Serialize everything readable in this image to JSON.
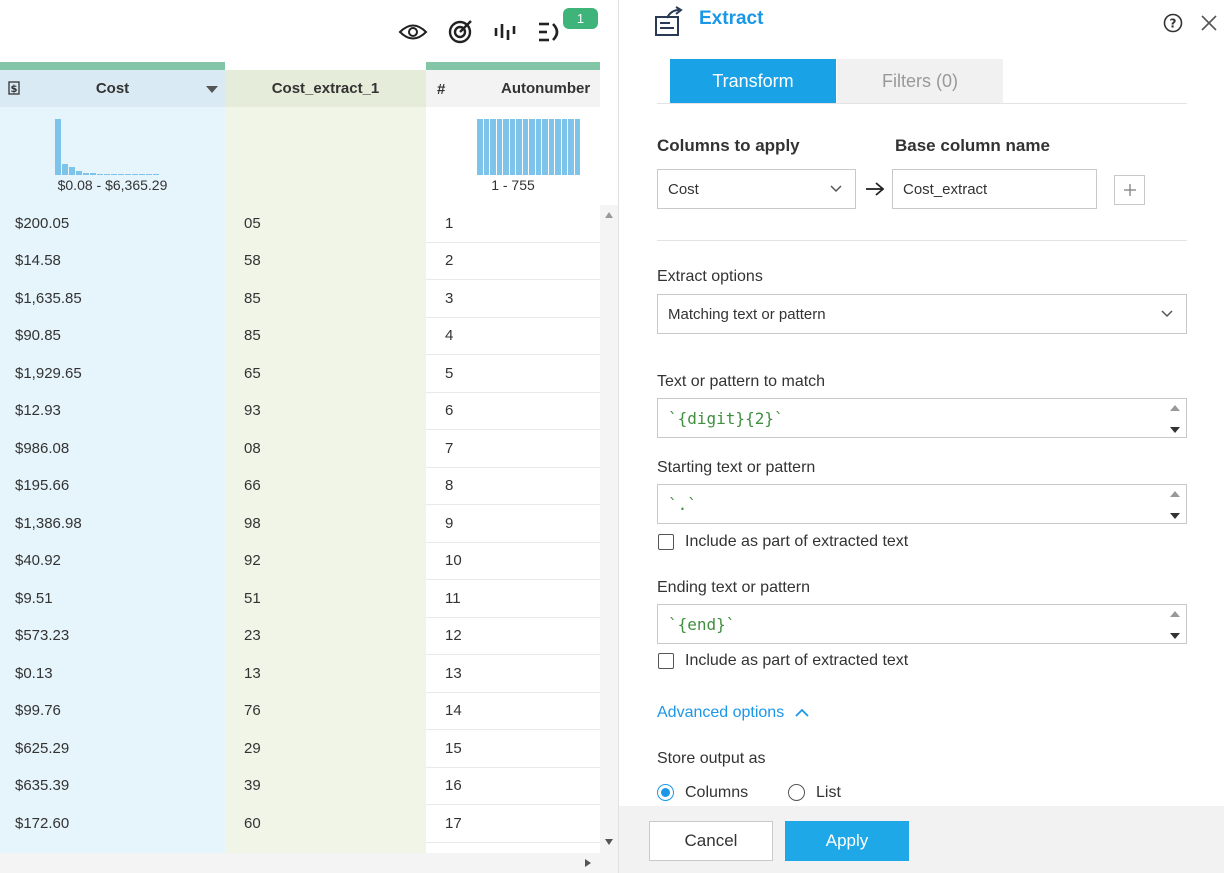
{
  "toolbar": {
    "icons": [
      "eye-icon",
      "target-icon",
      "pulse-icon",
      "steps-icon"
    ],
    "badge_count": "1"
  },
  "grid": {
    "columns": [
      {
        "type_icon": "$",
        "name": "Cost",
        "range": "$0.08 - $6,365.29"
      },
      {
        "type_icon": "",
        "name": "Cost_extract_1",
        "range": ""
      },
      {
        "type_icon": "#",
        "name": "Autonumber",
        "range": "1 - 755"
      }
    ],
    "rows": [
      {
        "cost": "$200.05",
        "extract": "05",
        "auto": "1"
      },
      {
        "cost": "$14.58",
        "extract": "58",
        "auto": "2"
      },
      {
        "cost": "$1,635.85",
        "extract": "85",
        "auto": "3"
      },
      {
        "cost": "$90.85",
        "extract": "85",
        "auto": "4"
      },
      {
        "cost": "$1,929.65",
        "extract": "65",
        "auto": "5"
      },
      {
        "cost": "$12.93",
        "extract": "93",
        "auto": "6"
      },
      {
        "cost": "$986.08",
        "extract": "08",
        "auto": "7"
      },
      {
        "cost": "$195.66",
        "extract": "66",
        "auto": "8"
      },
      {
        "cost": "$1,386.98",
        "extract": "98",
        "auto": "9"
      },
      {
        "cost": "$40.92",
        "extract": "92",
        "auto": "10"
      },
      {
        "cost": "$9.51",
        "extract": "51",
        "auto": "11"
      },
      {
        "cost": "$573.23",
        "extract": "23",
        "auto": "12"
      },
      {
        "cost": "$0.13",
        "extract": "13",
        "auto": "13"
      },
      {
        "cost": "$99.76",
        "extract": "76",
        "auto": "14"
      },
      {
        "cost": "$625.29",
        "extract": "29",
        "auto": "15"
      },
      {
        "cost": "$635.39",
        "extract": "39",
        "auto": "16"
      },
      {
        "cost": "$172.60",
        "extract": "60",
        "auto": "17"
      }
    ]
  },
  "panel": {
    "title": "Extract",
    "tabs": {
      "transform": "Transform",
      "filters": "Filters (0)"
    },
    "columns_to_apply": {
      "label": "Columns to apply",
      "value": "Cost"
    },
    "base_column_name": {
      "label": "Base column name",
      "value": "Cost_extract"
    },
    "extract_options": {
      "label": "Extract options",
      "value": "Matching text or pattern"
    },
    "pattern_to_match": {
      "label": "Text or pattern to match",
      "value": "`{digit}{2}`"
    },
    "starting_pattern": {
      "label": "Starting text or pattern",
      "value": "`.`",
      "include_label": "Include as part of extracted text"
    },
    "ending_pattern": {
      "label": "Ending text or pattern",
      "value": "`{end}`",
      "include_label": "Include as part of extracted text"
    },
    "advanced_options": "Advanced options",
    "store_output": {
      "label": "Store output as",
      "options": [
        "Columns",
        "List"
      ],
      "selected": "Columns"
    },
    "buttons": {
      "cancel": "Cancel",
      "apply": "Apply"
    }
  },
  "colors": {
    "accent": "#1b97e8",
    "tab_active": "#19a3e6",
    "badge": "#3fb47a",
    "cost_col": "#e6f4fc",
    "extract_col": "#f0f5e8"
  }
}
